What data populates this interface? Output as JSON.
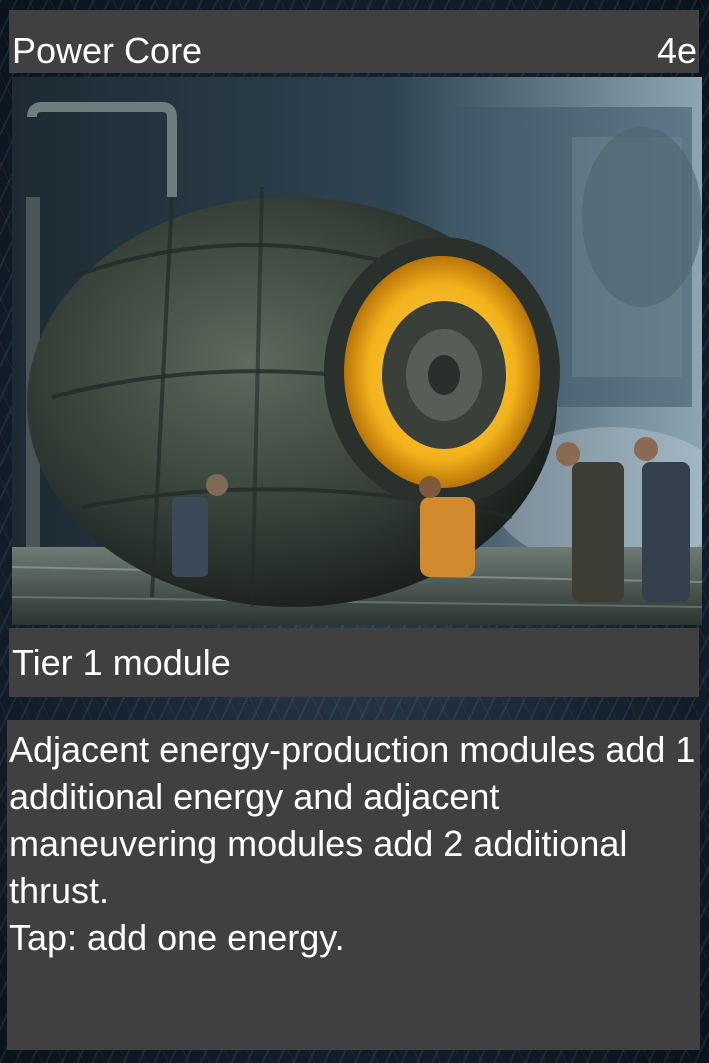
{
  "card": {
    "name": "Power Core",
    "cost": "4e",
    "type_line": "Tier 1 module",
    "rules_text": [
      "Adjacent energy-production modules add 1 additional energy and adjacent maneuvering modules add 2 additional thrust.",
      "Tap: add one energy."
    ]
  },
  "colors": {
    "panel": "#404040",
    "text": "#ffffff",
    "core_glow": "#f2b21b"
  }
}
